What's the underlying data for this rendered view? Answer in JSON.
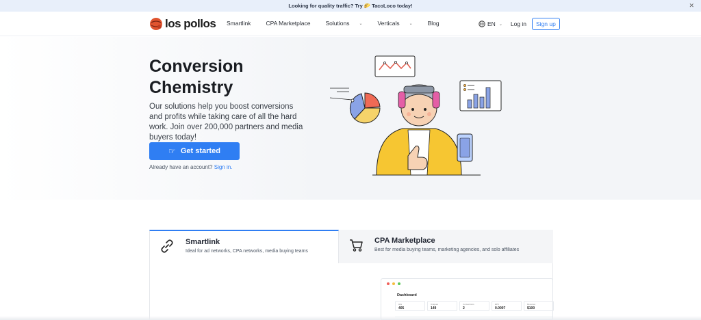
{
  "banner": {
    "text_before": "Looking for quality traffic? Try ",
    "emoji": "🌮",
    "text_after": " TacoLoco today!",
    "close": "✕"
  },
  "nav": {
    "logo_text": "los pollos",
    "items": [
      {
        "label": "Smartlink",
        "dropdown": false
      },
      {
        "label": "CPA Marketplace",
        "dropdown": false
      },
      {
        "label": "Solutions",
        "dropdown": true
      },
      {
        "label": "Verticals",
        "dropdown": true
      },
      {
        "label": "Blog",
        "dropdown": false
      }
    ],
    "lang": "EN",
    "login": "Log in",
    "signup": "Sign up"
  },
  "hero": {
    "title_line1": "Conversion",
    "title_line2": "Chemistry",
    "description": "Our solutions help you boost conversions and profits while taking care of all the hard work. Join over 200,000 partners and media buyers today!",
    "cta": "Get started",
    "already": "Already have an account? ",
    "signin": "Sign in."
  },
  "tabs": [
    {
      "title": "Smartlink",
      "subtitle": "Ideal for ad networks, CPA networks, media buying teams",
      "icon": "link-icon",
      "active": true
    },
    {
      "title": "CPA Marketplace",
      "subtitle": "Best for media buying teams, marketing agencies, and solo affiliates",
      "icon": "cart-icon",
      "active": false
    }
  ],
  "dashboard": {
    "title": "Dashboard",
    "stats": [
      {
        "label": "Hits",
        "value": "405"
      },
      {
        "label": "Uniques",
        "value": "149"
      },
      {
        "label": "Conversions",
        "value": "2"
      },
      {
        "label": "EPC",
        "value": "0.0007"
      },
      {
        "label": "Revenue",
        "value": "$100"
      }
    ]
  },
  "colors": {
    "accent": "#2f7ef3",
    "banner_bg": "#e8effa",
    "hero_bg": "#f3f5f8"
  }
}
